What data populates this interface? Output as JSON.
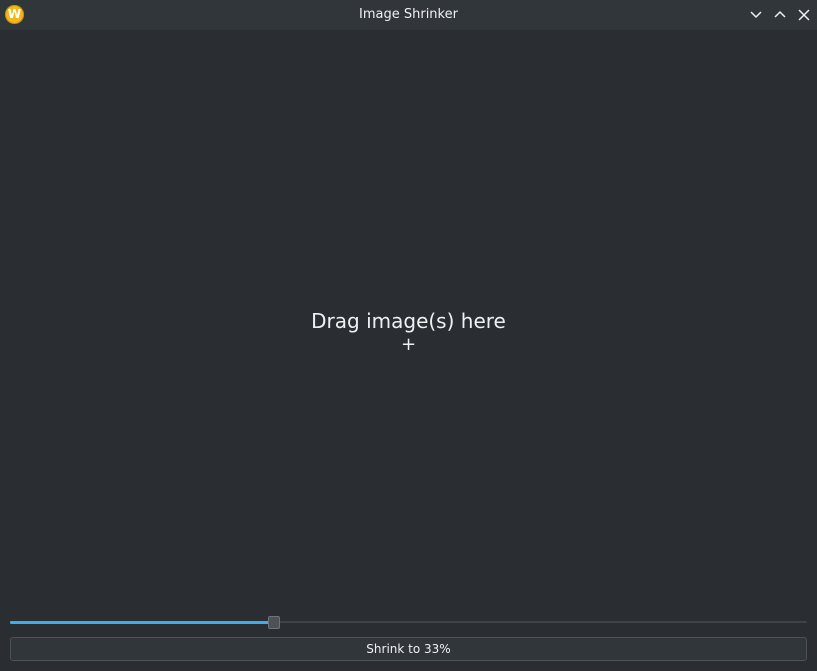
{
  "window": {
    "title": "Image Shrinker",
    "app_icon_glyph": "W",
    "app_icon_color": "#f0b81c",
    "buttons": {
      "minimize_icon": "chevron-down-icon",
      "maximize_icon": "chevron-up-icon",
      "close_icon": "close-icon"
    }
  },
  "drop_zone": {
    "label": "Drag image(s) here",
    "plus": "+"
  },
  "slider": {
    "value_fraction": 0.33,
    "accent_color": "#3daee9"
  },
  "action": {
    "label": "Shrink to 33%"
  }
}
